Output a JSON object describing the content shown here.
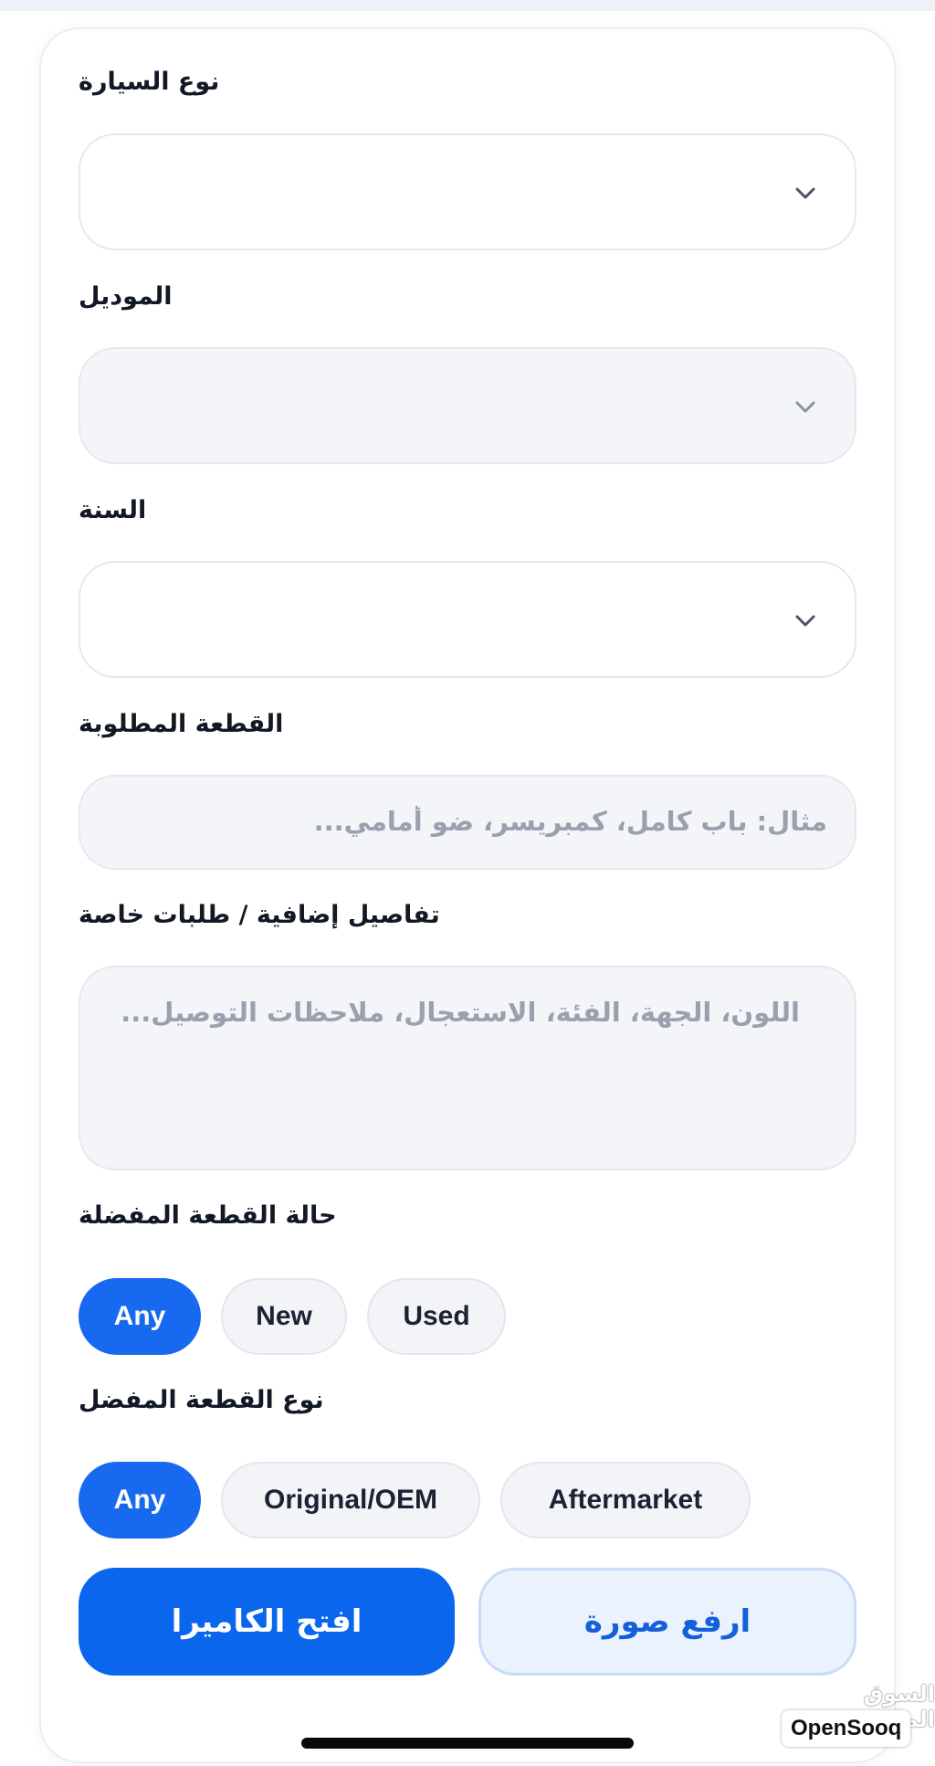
{
  "form": {
    "car_type": {
      "label": "نوع السيارة",
      "value": ""
    },
    "model": {
      "label": "الموديل",
      "value": ""
    },
    "year": {
      "label": "السنة",
      "value": ""
    },
    "part": {
      "label": "القطعة المطلوبة",
      "placeholder": "مثال: باب كامل، كمبريسر، ضو أمامي..."
    },
    "details": {
      "label": "تفاصيل إضافية / طلبات خاصة",
      "placeholder": "اللون، الجهة، الفئة، الاستعجال، ملاحظات التوصيل..."
    },
    "condition": {
      "label": "حالة القطعة المفضلة",
      "options": [
        "Any",
        "New",
        "Used"
      ],
      "selected": "Any"
    },
    "part_kind": {
      "label": "نوع القطعة المفضل",
      "options": [
        "Any",
        "Original/OEM",
        "Aftermarket"
      ],
      "selected": "Any"
    }
  },
  "actions": {
    "open_camera": "افتح الكاميرا",
    "upload_photo": "ارفع صورة"
  },
  "watermark": {
    "arabic": "السوق المفتوح",
    "brand": "OpenSooq"
  },
  "colors": {
    "accent": "#1769f0",
    "label_text": "#121826",
    "placeholder_text": "#9aa1ae",
    "field_border": "#e5e8ee"
  },
  "icons": {
    "dropdown": "chevron-down-icon"
  }
}
